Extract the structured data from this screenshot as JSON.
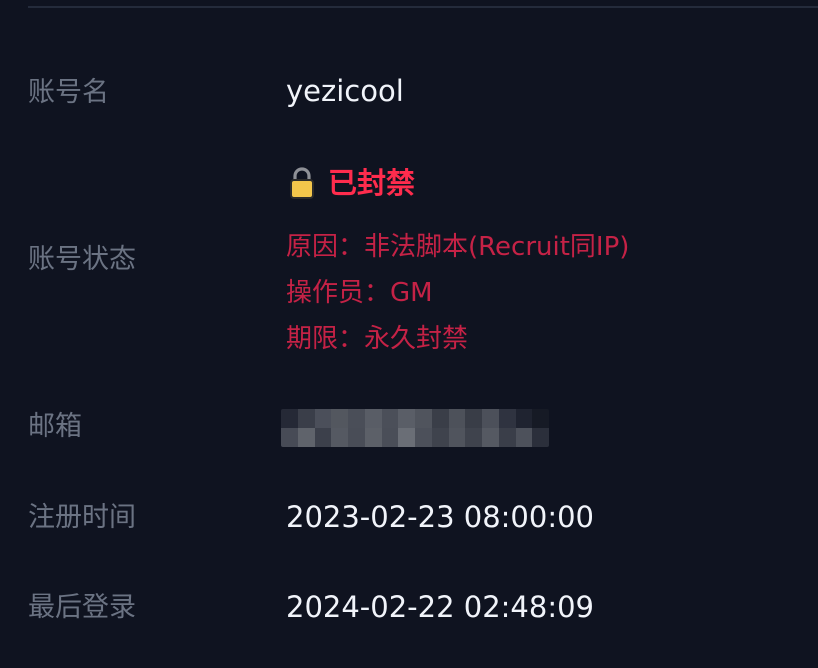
{
  "account": {
    "name_label": "账号名",
    "name_value": "yezicool",
    "status_label": "账号状态",
    "status": {
      "icon": "lock-icon",
      "title": "已封禁",
      "reason": "原因：非法脚本(Recruit同IP)",
      "operator": "操作员：GM",
      "duration": "期限：永久封禁"
    },
    "email_label": "邮箱",
    "register_label": "注册时间",
    "register_value": "2023-02-23 08:00:00",
    "last_login_label": "最后登录",
    "last_login_value": "2024-02-22 02:48:09"
  },
  "colors": {
    "background": "#0f1320",
    "label": "#6b7383",
    "value": "#f1f4fa",
    "ban_title": "#ff2c4d",
    "ban_detail": "#c52246",
    "lock": "#f3c64b"
  }
}
